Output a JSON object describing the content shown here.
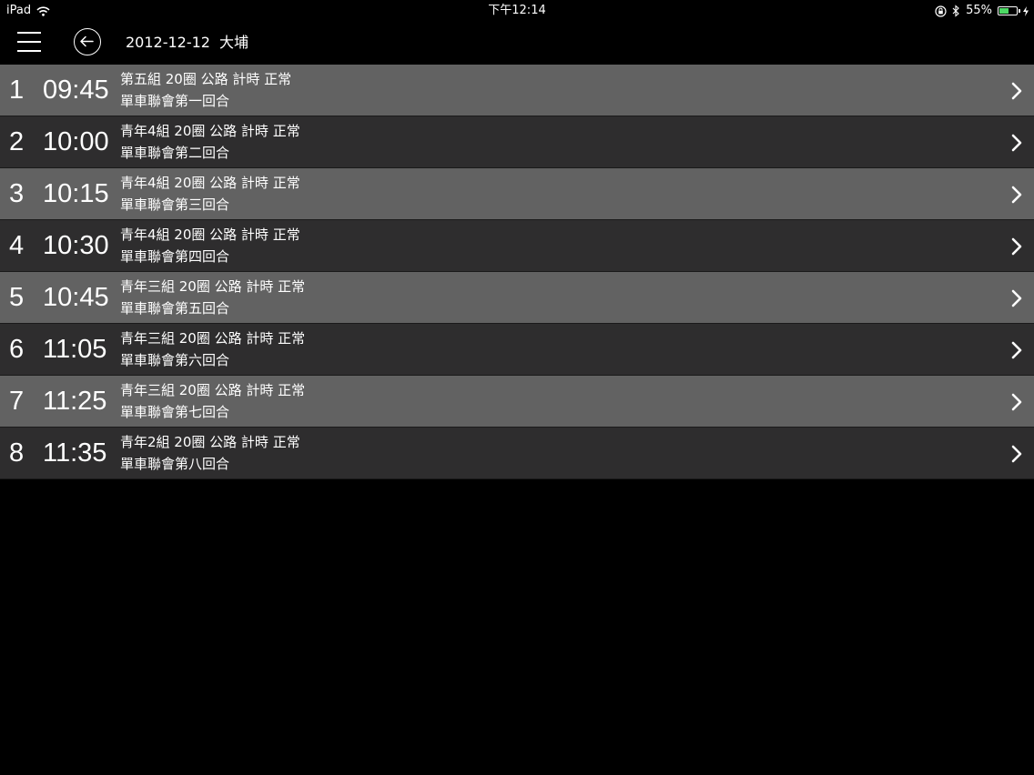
{
  "status_bar": {
    "device": "iPad",
    "time": "下午12:14",
    "battery": "55%",
    "battery_level": 0.55
  },
  "header": {
    "date": "2012-12-12",
    "location": "大埔"
  },
  "races": [
    {
      "number": "1",
      "time": "09:45",
      "details": "第五組 20圈 公路 計時 正常",
      "event": "單車聯會第一回合"
    },
    {
      "number": "2",
      "time": "10:00",
      "details": "青年4組 20圈 公路 計時 正常",
      "event": "單車聯會第二回合"
    },
    {
      "number": "3",
      "time": "10:15",
      "details": "青年4組 20圈 公路 計時 正常",
      "event": "單車聯會第三回合"
    },
    {
      "number": "4",
      "time": "10:30",
      "details": "青年4組 20圈 公路 計時 正常",
      "event": "單車聯會第四回合"
    },
    {
      "number": "5",
      "time": "10:45",
      "details": "青年三組 20圈 公路 計時 正常",
      "event": "單車聯會第五回合"
    },
    {
      "number": "6",
      "time": "11:05",
      "details": "青年三組 20圈 公路 計時 正常",
      "event": "單車聯會第六回合"
    },
    {
      "number": "7",
      "time": "11:25",
      "details": "青年三組 20圈 公路 計時 正常",
      "event": "單車聯會第七回合"
    },
    {
      "number": "8",
      "time": "11:35",
      "details": "青年2組 20圈 公路 計時 正常",
      "event": "單車聯會第八回合"
    }
  ],
  "colors": {
    "row_light": "#626262",
    "row_dark": "#2e2d2e",
    "background": "#000000",
    "battery": "#4cd964"
  }
}
